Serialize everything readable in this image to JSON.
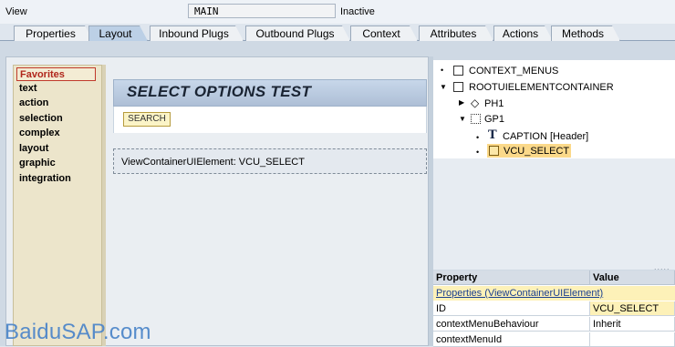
{
  "header": {
    "view_label": "View",
    "view_name": "MAIN",
    "status": "Inactive"
  },
  "tabs": [
    {
      "label": "Properties",
      "active": false
    },
    {
      "label": "Layout",
      "active": true
    },
    {
      "label": "Inbound Plugs",
      "active": false
    },
    {
      "label": "Outbound Plugs",
      "active": false
    },
    {
      "label": "Context",
      "active": false
    },
    {
      "label": "Attributes",
      "active": false
    },
    {
      "label": "Actions",
      "active": false
    },
    {
      "label": "Methods",
      "active": false
    }
  ],
  "palette": {
    "items": [
      "Favorites",
      "text",
      "action",
      "selection",
      "complex",
      "layout",
      "graphic",
      "integration"
    ],
    "selected": "Favorites"
  },
  "preview": {
    "title": "SELECT OPTIONS TEST",
    "button_label": "SEARCH",
    "container_label": "ViewContainerUIElement: VCU_SELECT"
  },
  "tree": {
    "nodes": [
      {
        "label": "CONTEXT_MENUS",
        "icon": "checkbox-icon"
      },
      {
        "label": "ROOTUIELEMENTCONTAINER",
        "icon": "checkbox-icon"
      },
      {
        "label": "PH1",
        "icon": "diamond-icon"
      },
      {
        "label": "GP1",
        "icon": "group-icon"
      },
      {
        "label": "CAPTION",
        "suffix": "[Header]",
        "icon": "text-T-icon"
      },
      {
        "label": "VCU_SELECT",
        "icon": "view-container-icon",
        "selected": true
      }
    ],
    "bullet": "•",
    "resize_glyph": "....."
  },
  "properties": {
    "col_property": "Property",
    "col_value": "Value",
    "group_link": "Properties (ViewContainerUIElement)",
    "rows": [
      {
        "name": "ID",
        "value": "VCU_SELECT"
      },
      {
        "name": "contextMenuBehaviour",
        "value": "Inherit"
      },
      {
        "name": "contextMenuId",
        "value": ""
      }
    ]
  },
  "watermark": "BaiduSAP.com",
  "colors": {
    "palette_bg": "#ece5cb",
    "selection_highlight": "#fdf1b8",
    "active_tab": "#bcd0e6",
    "watermark": "#4f87c9"
  }
}
